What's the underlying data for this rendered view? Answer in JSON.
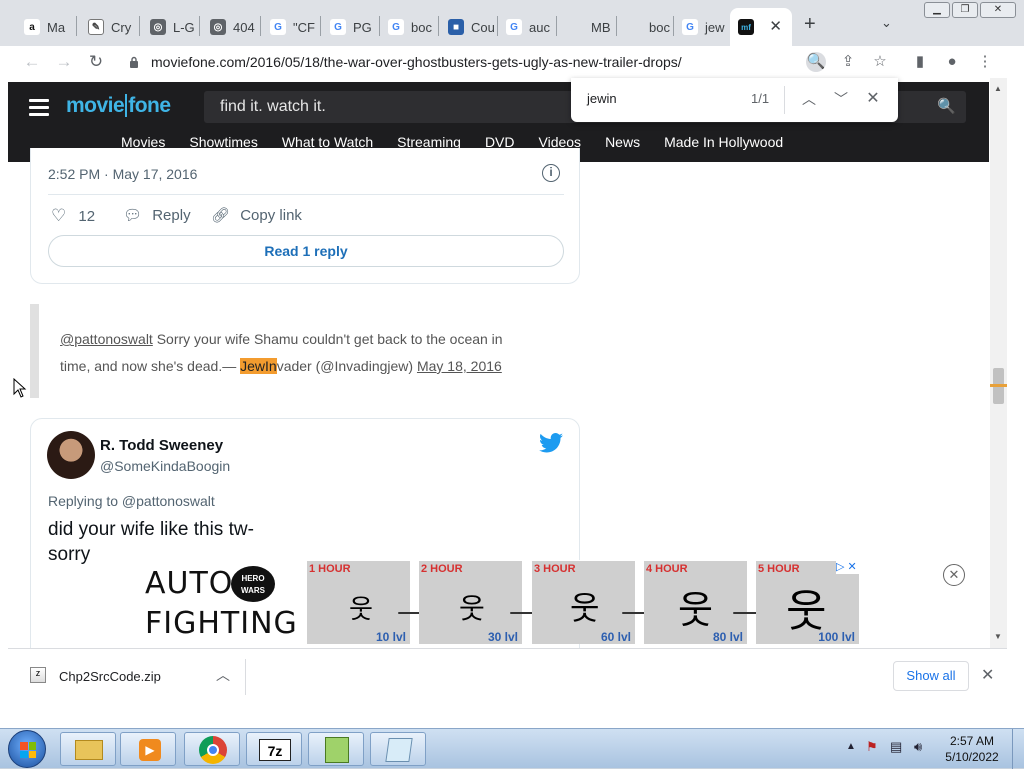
{
  "tabs": [
    {
      "label": "Ma"
    },
    {
      "label": "Cry"
    },
    {
      "label": "L-G"
    },
    {
      "label": "404"
    },
    {
      "label": "\"CF"
    },
    {
      "label": "PG"
    },
    {
      "label": "boc"
    },
    {
      "label": "Cou"
    },
    {
      "label": "auc"
    },
    {
      "label": "MB"
    },
    {
      "label": "boc"
    },
    {
      "label": "jew"
    },
    {
      "label": ""
    }
  ],
  "new_tab": "+",
  "address": "moviefone.com/2016/05/18/the-war-over-ghostbusters-gets-ugly-as-new-trailer-drops/",
  "find": {
    "query": "jewin",
    "count": "1/1"
  },
  "site": {
    "logo_part1": "movie",
    "logo_part2": "fone",
    "search_text": "find it. watch it.",
    "nav": [
      "Movies",
      "Showtimes",
      "What to Watch",
      "Streaming",
      "DVD",
      "Videos",
      "News",
      "Made In Hollywood"
    ]
  },
  "tweet1": {
    "timestamp": "2:52 PM · May 17, 2016",
    "likes": "12",
    "reply_label": "Reply",
    "copy_label": "Copy link",
    "read_reply": "Read 1 reply"
  },
  "quote": {
    "mention": "@pattonoswalt",
    "text1": " Sorry your wife Shamu couldn't get back to the ocean in",
    "text2": "time, and now she's dead.— ",
    "highlight": "JewIn",
    "after_highlight": "vader (@Invadingjew) ",
    "date_link": "May 18, 2016"
  },
  "tweet2": {
    "name": "R. Todd Sweeney",
    "handle": "@SomeKindaBoogin",
    "replying": "Replying to @pattonoswalt",
    "text1": "did your wife like this tw-",
    "text2": "sorry"
  },
  "ad": {
    "word1": "AUTO",
    "word2": "FIGHTING",
    "brand_line1": "HERO",
    "brand_line2": "WARS",
    "stages": [
      {
        "hour": "1 HOUR",
        "level": "10 lvl"
      },
      {
        "hour": "2 HOUR",
        "level": "30 lvl"
      },
      {
        "hour": "3 HOUR",
        "level": "60 lvl"
      },
      {
        "hour": "4 HOUR",
        "level": "80 lvl"
      },
      {
        "hour": "5 HOUR",
        "level": "100 lvl"
      }
    ]
  },
  "download": {
    "filename": "Chp2SrcCode.zip",
    "show_all": "Show all"
  },
  "clock": {
    "time": "2:57 AM",
    "date": "5/10/2022"
  },
  "colors": {
    "logo": "#3fb4e5",
    "header": "#1d1d1f",
    "link": "#1d6fb8",
    "highlight": "#f39c2f"
  }
}
